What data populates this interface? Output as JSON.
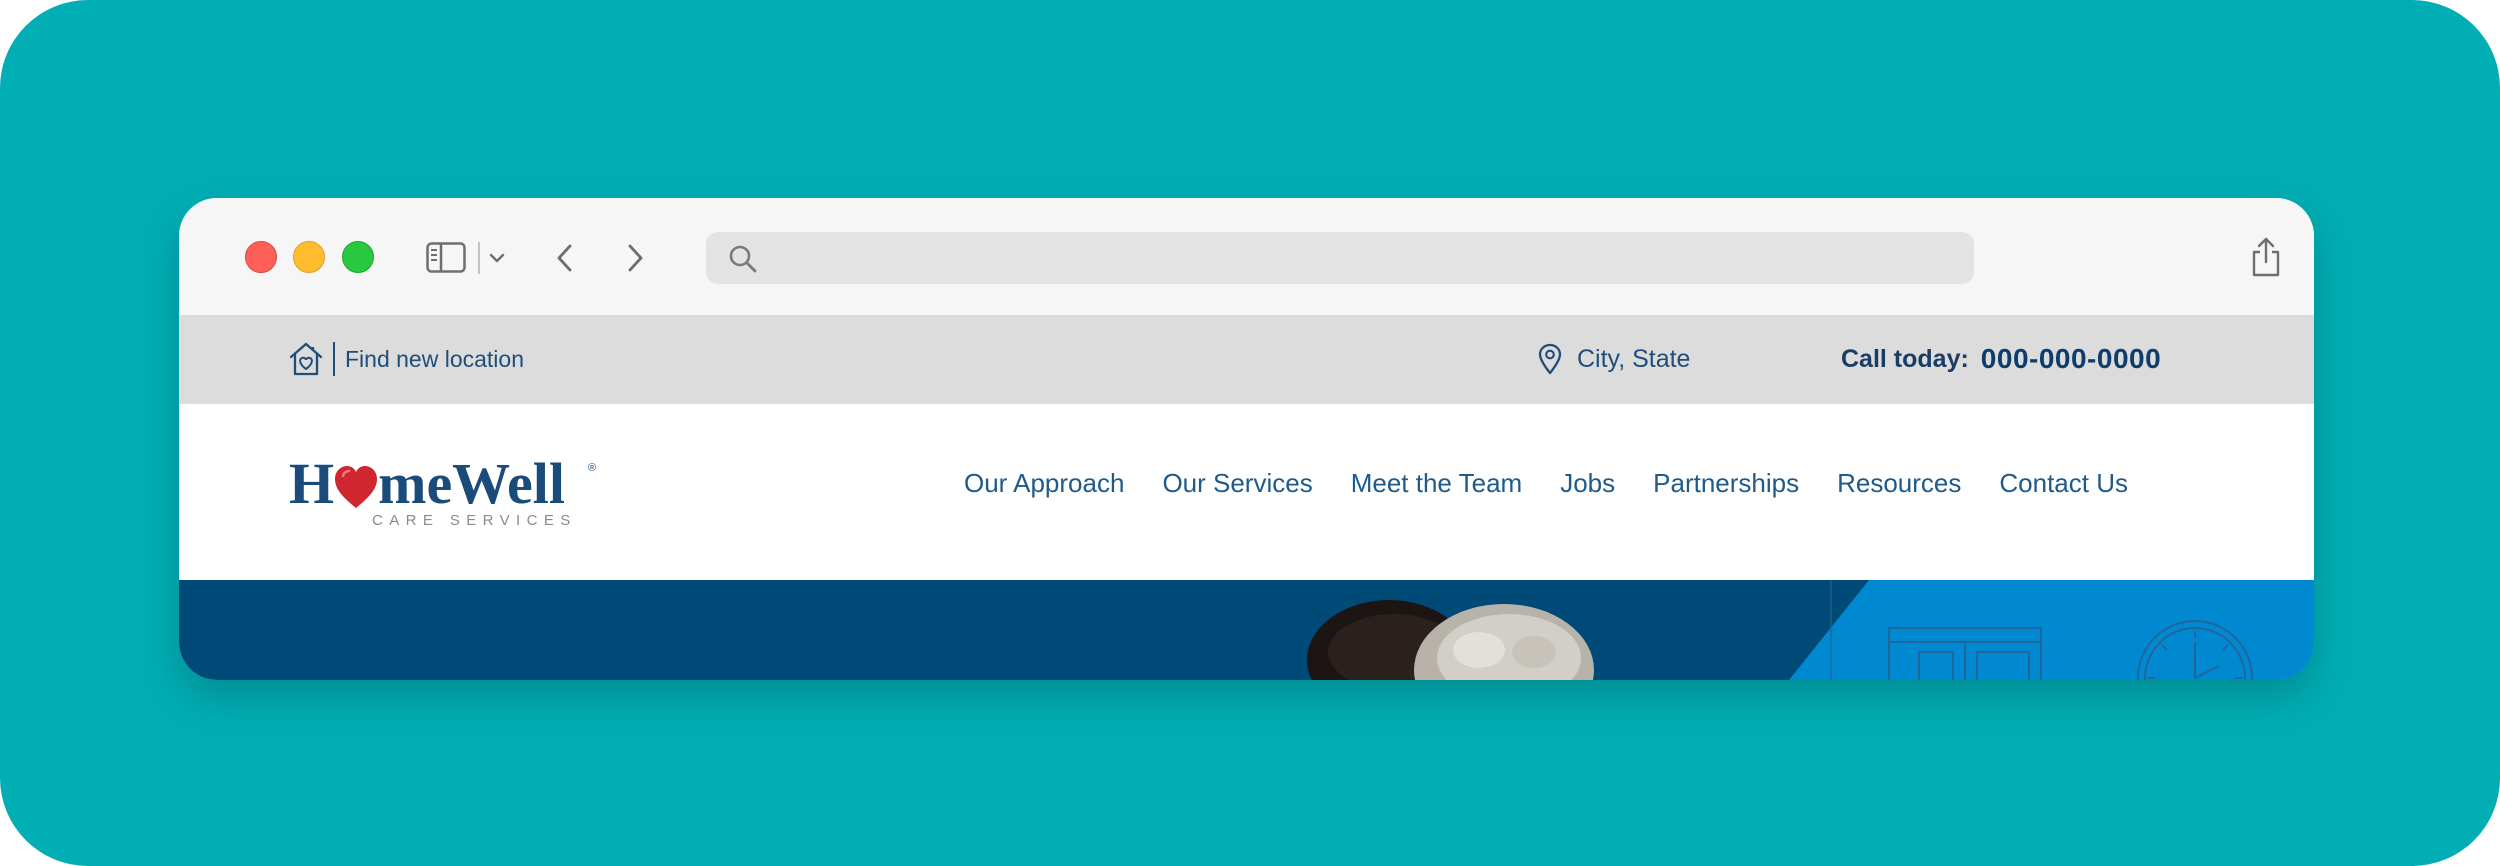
{
  "browser": {
    "address_placeholder": ""
  },
  "topbar": {
    "find_location_label": "Find new location",
    "city_state": "City, State",
    "call_label": "Call today:",
    "phone": "000-000-0000"
  },
  "logo": {
    "name_part1": "H",
    "name_part2": "meWell",
    "registered": "®",
    "tagline": "CARE SERVICES"
  },
  "nav": {
    "items": [
      {
        "label": "Our Approach"
      },
      {
        "label": "Our Services"
      },
      {
        "label": "Meet the Team"
      },
      {
        "label": "Jobs"
      },
      {
        "label": "Partnerships"
      },
      {
        "label": "Resources"
      },
      {
        "label": "Contact Us"
      }
    ]
  },
  "colors": {
    "backdrop": "#00aeb4",
    "brand_navy": "#1a4b7a",
    "hero_navy": "#004a78",
    "hero_blue": "#0088d1",
    "heart_red": "#d0262f",
    "topbar_gray": "#dcdcdc"
  },
  "icons": {
    "find_location": "house-heart-icon",
    "city": "map-pin-icon",
    "sidebar": "sidebar-toggle-icon",
    "back": "chevron-left-icon",
    "forward": "chevron-right-icon",
    "search": "search-icon",
    "share": "share-icon",
    "new_tab": "plus-icon",
    "tabs": "tab-overview-icon"
  }
}
